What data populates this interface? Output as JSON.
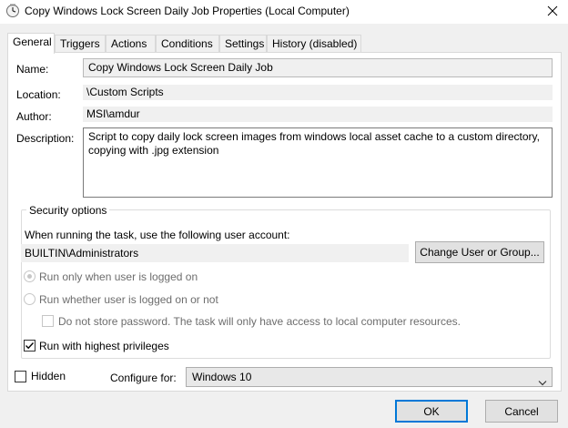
{
  "window": {
    "title": "Copy Windows Lock Screen Daily Job Properties (Local Computer)",
    "icon": "task-scheduler-clock-icon",
    "close_icon": "close-icon"
  },
  "tabs": [
    {
      "label": "General",
      "active": true
    },
    {
      "label": "Triggers",
      "active": false
    },
    {
      "label": "Actions",
      "active": false
    },
    {
      "label": "Conditions",
      "active": false
    },
    {
      "label": "Settings",
      "active": false
    },
    {
      "label": "History (disabled)",
      "active": false
    }
  ],
  "general": {
    "name_label": "Name:",
    "name_value": "Copy Windows Lock Screen Daily Job",
    "location_label": "Location:",
    "location_value": "\\Custom Scripts",
    "author_label": "Author:",
    "author_value": "MSI\\amdur",
    "description_label": "Description:",
    "description_value": "Script to copy daily lock screen images from windows local asset cache to a custom directory, copying with .jpg extension"
  },
  "security": {
    "group_label": "Security options",
    "account_prompt": "When running the task, use the following user account:",
    "account_value": "BUILTIN\\Administrators",
    "change_button": "Change User or Group...",
    "radio_logged_on": "Run only when user is logged on",
    "radio_logged_on_selected": true,
    "radio_whether": "Run whether user is logged on or not",
    "no_store_password": "Do not store password.  The task will only have access to local computer resources.",
    "no_store_password_checked": false,
    "highest_privileges": "Run with highest privileges",
    "highest_privileges_checked": true
  },
  "bottom": {
    "hidden_label": "Hidden",
    "hidden_checked": false,
    "configure_label": "Configure for:",
    "configure_value": "Windows 10"
  },
  "buttons": {
    "ok": "OK",
    "cancel": "Cancel"
  },
  "colors": {
    "accent": "#0078d7",
    "window_bg": "#f0f0f0",
    "panel_bg": "#ffffff",
    "disabled_text": "#6d6d6d"
  }
}
